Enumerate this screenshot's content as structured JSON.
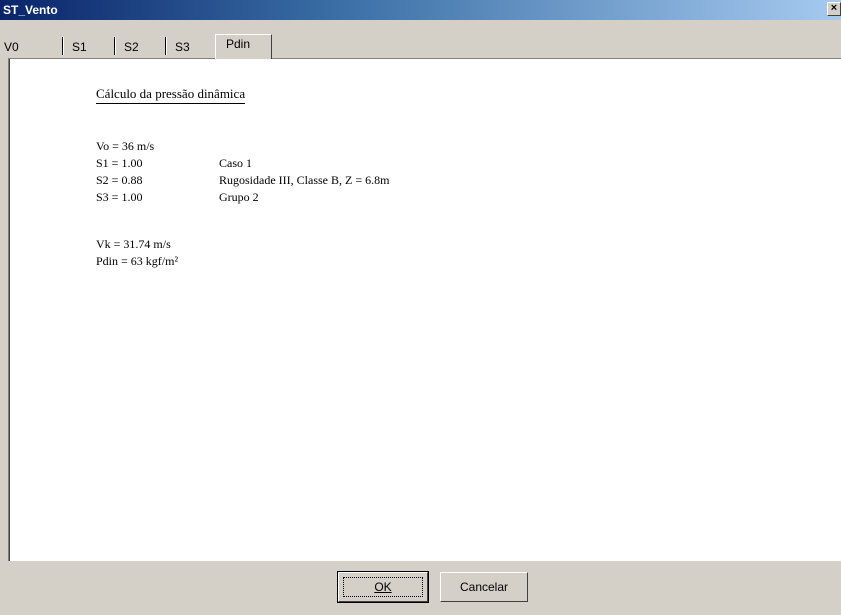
{
  "window": {
    "title": "ST_Vento",
    "close_glyph": "✕"
  },
  "tabs": [
    {
      "label": "V0"
    },
    {
      "label": "S1"
    },
    {
      "label": "S2"
    },
    {
      "label": "S3"
    },
    {
      "label": "Pdin"
    }
  ],
  "active_tab": "Pdin",
  "report": {
    "heading": "Cálculo da pressão dinâmica",
    "lines": [
      {
        "left": "Vo = 36 m/s",
        "right": ""
      },
      {
        "left": "S1 = 1.00",
        "right": "Caso 1"
      },
      {
        "left": "S2 = 0.88",
        "right": "Rugosidade III, Classe B, Z = 6.8m"
      },
      {
        "left": "S3 = 1.00",
        "right": "Grupo 2"
      }
    ],
    "results": [
      {
        "text": "Vk = 31.74 m/s"
      },
      {
        "text": "Pdin = 63 kgf/m²"
      }
    ]
  },
  "buttons": {
    "ok_label": "OK",
    "cancel_label": "Cancelar"
  }
}
